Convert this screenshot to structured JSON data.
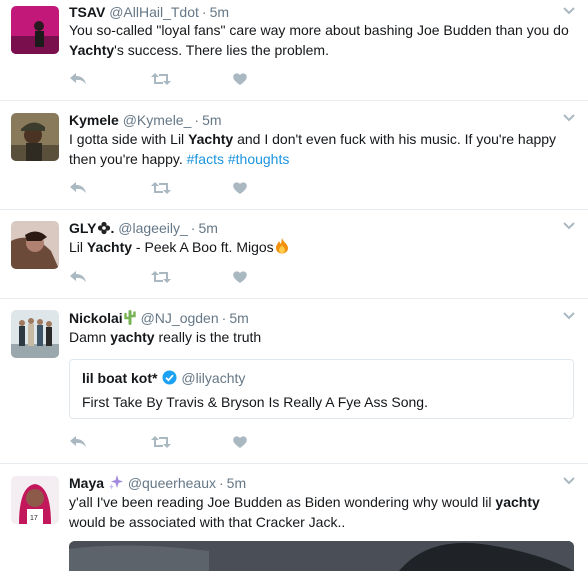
{
  "tweets": [
    {
      "fullname": "TSAV",
      "username": "@AllHail_Tdot",
      "time": "5m",
      "text_before": "You so-called \"loyal fans\" care way more about bashing Joe Budden than you do ",
      "text_bold": "Yachty",
      "text_after": "'s success. There lies the problem."
    },
    {
      "fullname": "Kymele",
      "username": "@Kymele_",
      "time": "5m",
      "text_before": "I gotta side with Lil ",
      "text_bold": "Yachty",
      "text_after": " and I don't even fuck with his music. If you're happy then you're happy. ",
      "hashtags": [
        "#facts",
        "#thoughts"
      ]
    },
    {
      "fullname": "GLY",
      "username": "@lageeily_",
      "time": "5m",
      "text_before": "Lil ",
      "text_bold": "Yachty",
      "text_after": " - Peek A Boo ft. Migos"
    },
    {
      "fullname": "Nickolai",
      "username": "@NJ_ogden",
      "time": "5m",
      "text_before": "Damn ",
      "text_bold": "yachty",
      "text_after": " really is the truth",
      "quote": {
        "fullname": "lil boat kot*",
        "username": "@lilyachty",
        "text": "First Take By Travis & Bryson Is Really A Fye Ass Song."
      }
    },
    {
      "fullname": "Maya",
      "username": "@queerheaux",
      "time": "5m",
      "text_before": "y'all I've been reading Joe Budden as Biden wondering why would lil ",
      "text_bold": "yachty",
      "text_after": " would be associated with that Cracker Jack.."
    }
  ],
  "colors": {
    "link": "#1b95e0",
    "meta": "#657786",
    "action_icon": "#aab8c2",
    "verified": "#1da1f2"
  },
  "icons": [
    "reply-icon",
    "retweet-icon",
    "like-icon",
    "caret-down-icon",
    "verified-badge-icon",
    "fire-emoji",
    "cactus-emoji",
    "sparkles-emoji",
    "flower-emoji"
  ]
}
